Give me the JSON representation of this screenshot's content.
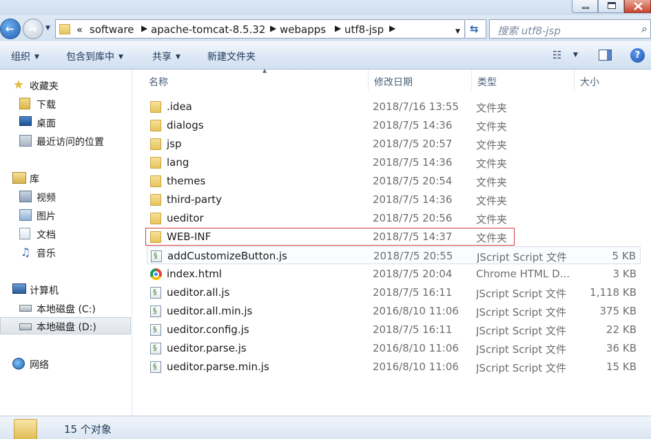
{
  "window": {
    "controls": [
      "minimize-icon",
      "maximize-icon",
      "close-icon"
    ]
  },
  "address": {
    "chevron": "«",
    "crumbs": [
      "software",
      "apache-tomcat-8.5.32",
      "webapps",
      "utf8-jsp"
    ],
    "search_placeholder": "搜索 utf8-jsp"
  },
  "toolbar": {
    "organize": "组织",
    "include_in_library": "包含到库中",
    "share": "共享",
    "new_folder": "新建文件夹"
  },
  "nav": {
    "favorites": "收藏夹",
    "downloads": "下载",
    "desktop": "桌面",
    "recent": "最近访问的位置",
    "libraries": "库",
    "videos": "视频",
    "pictures": "图片",
    "documents": "文档",
    "music": "音乐",
    "computer": "计算机",
    "drive_c": "本地磁盘 (C:)",
    "drive_d": "本地磁盘 (D:)",
    "network": "网络"
  },
  "columns": {
    "name": "名称",
    "modified": "修改日期",
    "type": "类型",
    "size": "大小"
  },
  "files": [
    {
      "name": ".idea",
      "date": "2018/7/16 13:55",
      "type": "文件夹",
      "size": "",
      "icon": "folder-icon"
    },
    {
      "name": "dialogs",
      "date": "2018/7/5 14:36",
      "type": "文件夹",
      "size": "",
      "icon": "folder-icon"
    },
    {
      "name": "jsp",
      "date": "2018/7/5 20:57",
      "type": "文件夹",
      "size": "",
      "icon": "folder-icon"
    },
    {
      "name": "lang",
      "date": "2018/7/5 14:36",
      "type": "文件夹",
      "size": "",
      "icon": "folder-icon"
    },
    {
      "name": "themes",
      "date": "2018/7/5 20:54",
      "type": "文件夹",
      "size": "",
      "icon": "folder-icon"
    },
    {
      "name": "third-party",
      "date": "2018/7/5 14:36",
      "type": "文件夹",
      "size": "",
      "icon": "folder-icon"
    },
    {
      "name": "ueditor",
      "date": "2018/7/5 20:56",
      "type": "文件夹",
      "size": "",
      "icon": "folder-icon"
    },
    {
      "name": "WEB-INF",
      "date": "2018/7/5 14:37",
      "type": "文件夹",
      "size": "",
      "icon": "folder-icon"
    },
    {
      "name": "addCustomizeButton.js",
      "date": "2018/7/5 20:55",
      "type": "JScript Script 文件",
      "size": "5 KB",
      "icon": "jscript-file-icon"
    },
    {
      "name": "index.html",
      "date": "2018/7/5 20:04",
      "type": "Chrome HTML D...",
      "size": "3 KB",
      "icon": "chrome-icon"
    },
    {
      "name": "ueditor.all.js",
      "date": "2018/7/5 16:11",
      "type": "JScript Script 文件",
      "size": "1,118 KB",
      "icon": "jscript-file-icon"
    },
    {
      "name": "ueditor.all.min.js",
      "date": "2016/8/10 11:06",
      "type": "JScript Script 文件",
      "size": "375 KB",
      "icon": "jscript-file-icon"
    },
    {
      "name": "ueditor.config.js",
      "date": "2018/7/5 16:11",
      "type": "JScript Script 文件",
      "size": "22 KB",
      "icon": "jscript-file-icon"
    },
    {
      "name": "ueditor.parse.js",
      "date": "2016/8/10 11:06",
      "type": "JScript Script 文件",
      "size": "36 KB",
      "icon": "jscript-file-icon"
    },
    {
      "name": "ueditor.parse.min.js",
      "date": "2016/8/10 11:06",
      "type": "JScript Script 文件",
      "size": "15 KB",
      "icon": "jscript-file-icon"
    }
  ],
  "status": {
    "count": "15 个对象"
  },
  "colors": {
    "highlight_border": "#d43a3a",
    "folder": "#e7c45a"
  }
}
